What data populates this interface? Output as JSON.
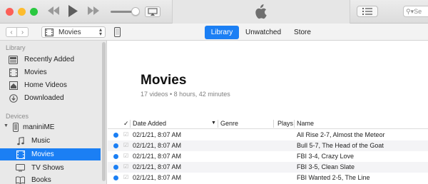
{
  "colors": {
    "accent": "#1b7ff4",
    "close": "#fc5f57",
    "minimize": "#fdbc2e",
    "maximize": "#2ac840",
    "unwatched_dot": "#1b7ff4"
  },
  "toolbar": {
    "icons": [
      "rewind-icon",
      "play-icon",
      "fast-forward-icon",
      "volume-slider",
      "airplay-icon",
      "apple-logo-icon",
      "list-view-icon",
      "search-icon"
    ],
    "search_placeholder": "Se"
  },
  "nav": {
    "media_kind": "Movies",
    "tabs": [
      {
        "label": "Library",
        "active": true
      },
      {
        "label": "Unwatched",
        "active": false
      },
      {
        "label": "Store",
        "active": false
      }
    ]
  },
  "sidebar": {
    "library_header": "Library",
    "library_items": [
      {
        "label": "Recently Added",
        "icon": "recently-added-icon"
      },
      {
        "label": "Movies",
        "icon": "film-icon"
      },
      {
        "label": "Home Videos",
        "icon": "home-videos-icon"
      },
      {
        "label": "Downloaded",
        "icon": "download-icon"
      }
    ],
    "devices_header": "Devices",
    "device": {
      "label": "maniniME",
      "icon": "iphone-icon"
    },
    "device_items": [
      {
        "label": "Music",
        "icon": "music-note-icon",
        "selected": false
      },
      {
        "label": "Movies",
        "icon": "film-icon",
        "selected": true
      },
      {
        "label": "TV Shows",
        "icon": "tv-icon",
        "selected": false
      },
      {
        "label": "Books",
        "icon": "book-icon",
        "selected": false
      }
    ]
  },
  "main": {
    "title": "Movies",
    "summary": "17 videos • 8 hours, 42 minutes",
    "columns": {
      "check": "✓",
      "date_added": "Date Added",
      "genre": "Genre",
      "plays": "Plays",
      "name": "Name"
    },
    "rows": [
      {
        "date": "02/1/21, 8:07 AM",
        "name": "All Rise 2-7, Almost the Meteor"
      },
      {
        "date": "02/1/21, 8:07 AM",
        "name": "Bull 5-7, The Head of the Goat"
      },
      {
        "date": "02/1/21, 8:07 AM",
        "name": "FBI 3-4, Crazy Love"
      },
      {
        "date": "02/1/21, 8:07 AM",
        "name": "FBI 3-5, Clean Slate"
      },
      {
        "date": "02/1/21, 8:07 AM",
        "name": "FBI Wanted 2-5, The Line"
      }
    ]
  }
}
